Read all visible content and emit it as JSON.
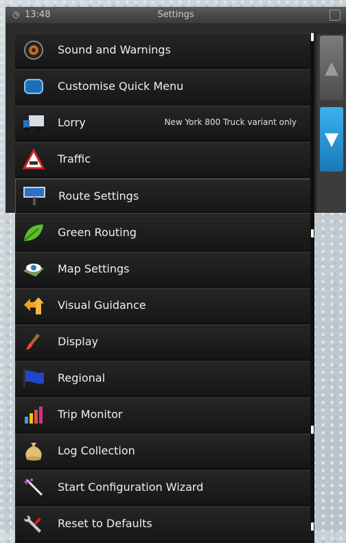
{
  "status": {
    "time": "13:48",
    "title": "Settings"
  },
  "menu": {
    "items": [
      {
        "label": "Sound and Warnings",
        "icon": "speaker-icon"
      },
      {
        "label": "Customise Quick Menu",
        "icon": "quick-menu-icon"
      },
      {
        "label": "Lorry",
        "icon": "truck-icon",
        "note": "New York 800 Truck variant only"
      },
      {
        "label": "Traffic",
        "icon": "traffic-warning-icon"
      },
      {
        "label": "Route Settings",
        "icon": "road-sign-icon"
      },
      {
        "label": "Green Routing",
        "icon": "leaf-icon"
      },
      {
        "label": "Map Settings",
        "icon": "map-eye-icon"
      },
      {
        "label": "Visual Guidance",
        "icon": "guidance-arrows-icon"
      },
      {
        "label": "Display",
        "icon": "paintbrush-icon"
      },
      {
        "label": "Regional",
        "icon": "flag-icon"
      },
      {
        "label": "Trip Monitor",
        "icon": "bar-chart-icon"
      },
      {
        "label": "Log Collection",
        "icon": "money-bag-icon"
      },
      {
        "label": "Start Configuration Wizard",
        "icon": "magic-wand-icon"
      },
      {
        "label": "Reset to Defaults",
        "icon": "wrench-icon"
      }
    ]
  },
  "colors": {
    "accent": "#2a96d8",
    "row_bg": "#1c1c1c"
  }
}
